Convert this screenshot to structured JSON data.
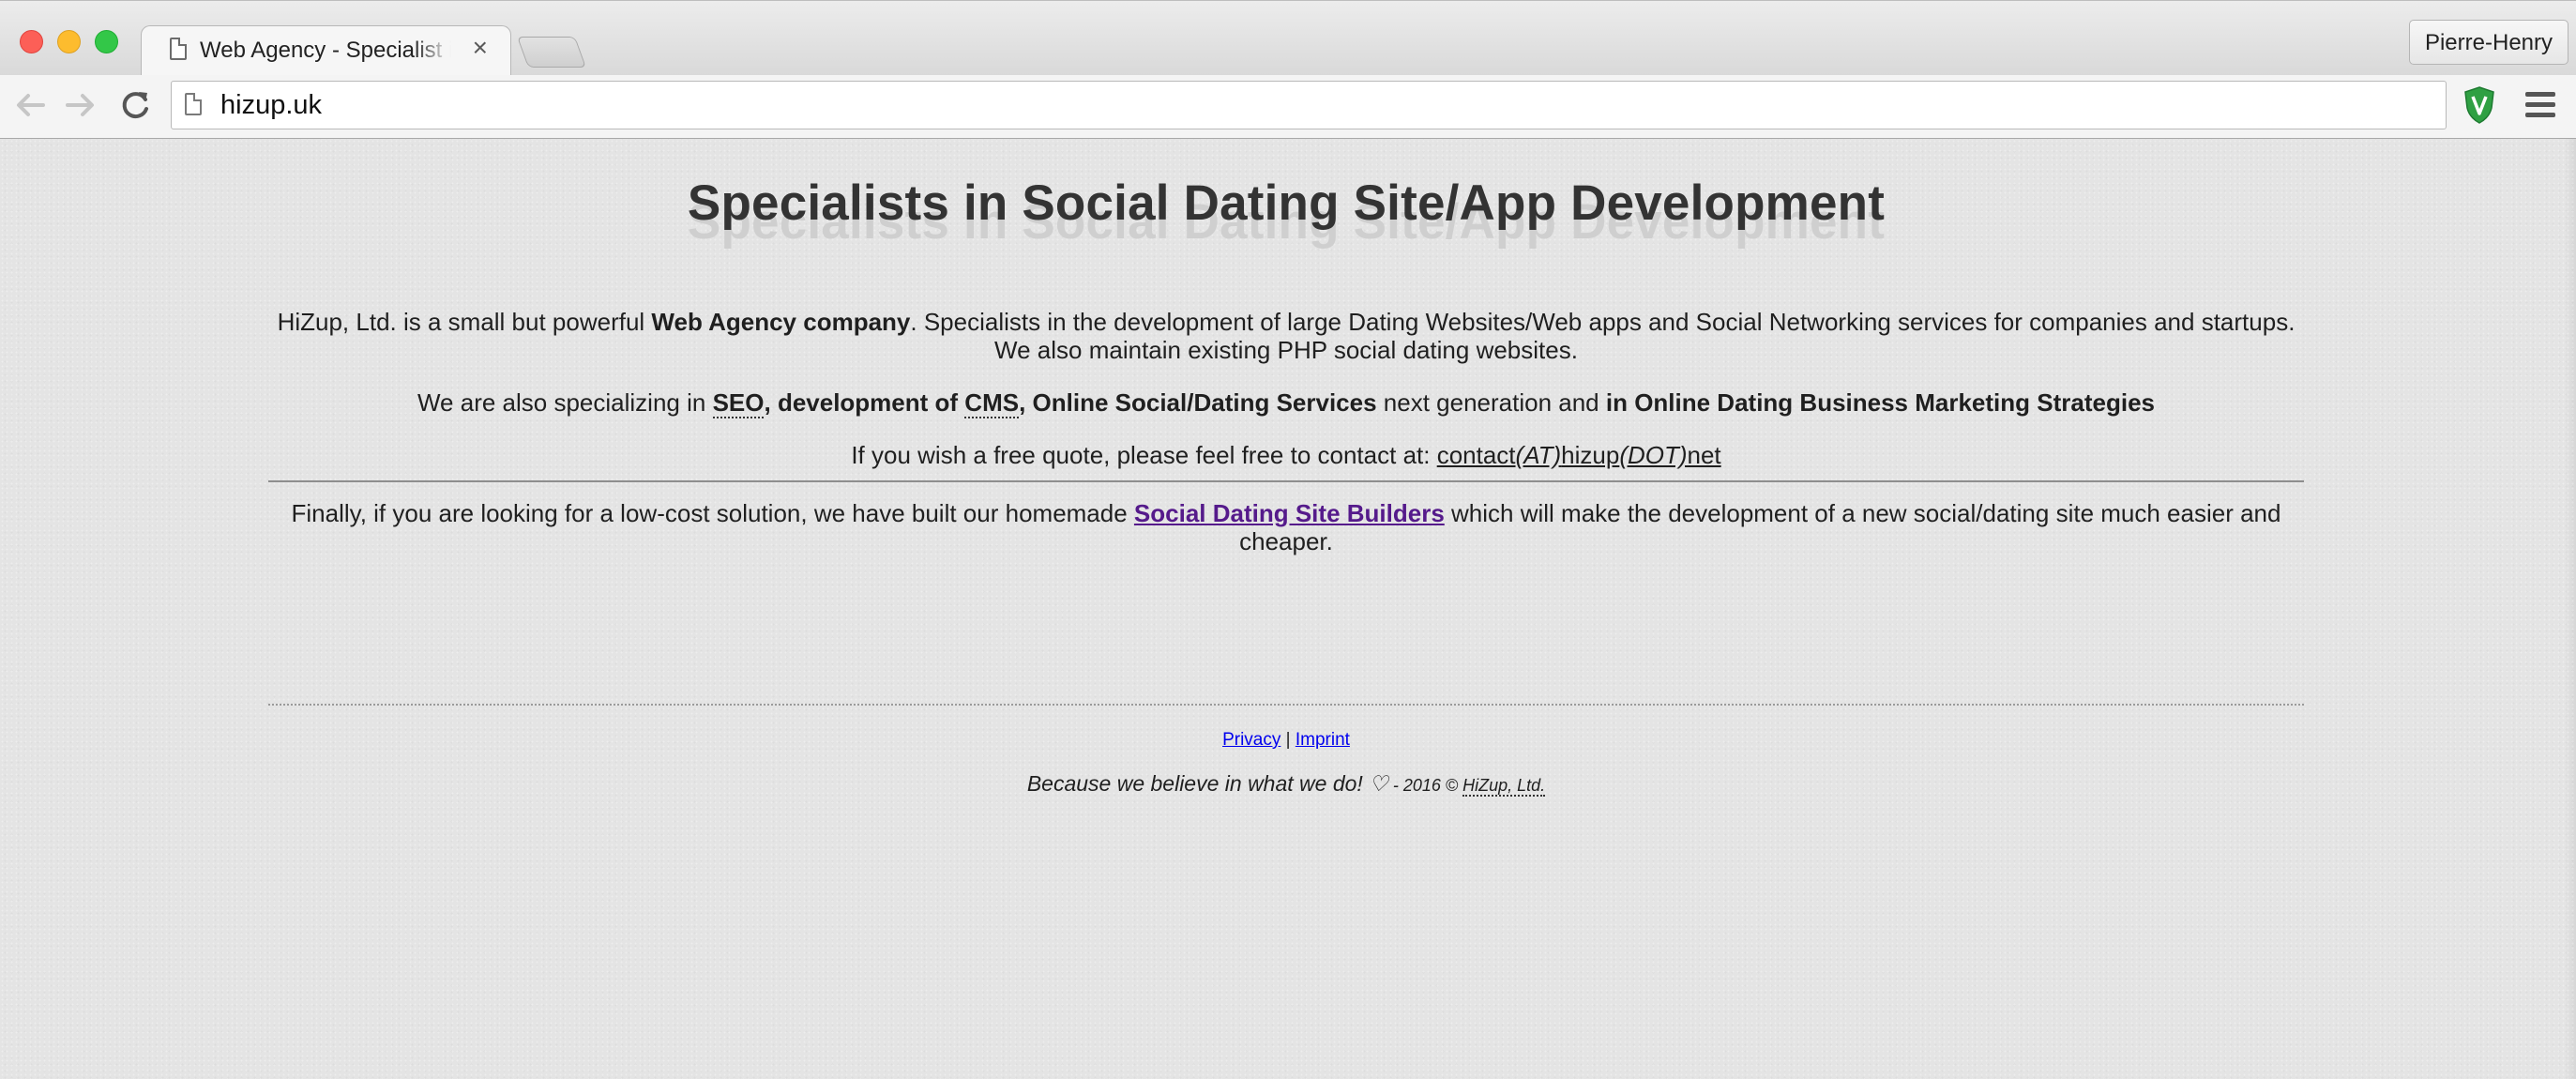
{
  "browser": {
    "tab_title": "Web Agency - Specialist in Social Dating Site/App Development",
    "tab_close": "×",
    "profile_name": "Pierre-Henry",
    "url": "hizup.uk",
    "icons": {
      "back": "arrow-left",
      "forward": "arrow-right",
      "reload": "reload",
      "extension": "green-shield",
      "menu": "hamburger"
    }
  },
  "page": {
    "headline": "Specialists in Social Dating Site/App Development",
    "intro": {
      "t1": "HiZup, Ltd. is a small but powerful ",
      "b1": "Web Agency company",
      "t2": ". Specialists in the development of large Dating Websites/Web apps and Social Networking services for companies and startups.",
      "t3": "We also maintain existing PHP social dating websites."
    },
    "specializing": {
      "t1": "We are also specializing in ",
      "seo": "SEO",
      "comma1": ", ",
      "dev_of": "development of ",
      "cms": "CMS",
      "comma2": ", ",
      "online": "Online Social/Dating Services",
      "t2": " next generation and ",
      "marketing": "in Online Dating Business Marketing Strategies"
    },
    "quote": {
      "text": "If you wish a free quote, please feel free to contact at: ",
      "contact_a": "contact",
      "contact_b": "(AT)",
      "contact_c": "hizup",
      "contact_d": "(DOT)",
      "contact_e": "net"
    },
    "builders": {
      "t1": "Finally, if you are looking for a low-cost solution, we have built our homemade ",
      "link": "Social Dating Site Builders",
      "t2": " which will make the development of a new social/dating site much easier and cheaper."
    },
    "footer": {
      "privacy": "Privacy",
      "sep": " | ",
      "imprint": "Imprint",
      "tagline": "Because we believe in what we do! ",
      "heart": "♡",
      "year": " - 2016 © ",
      "company": "HiZup, Ltd."
    }
  },
  "colors": {
    "visited_link": "#551a8b",
    "footer_link": "#0000ee",
    "shield_green": "#2fa043"
  }
}
